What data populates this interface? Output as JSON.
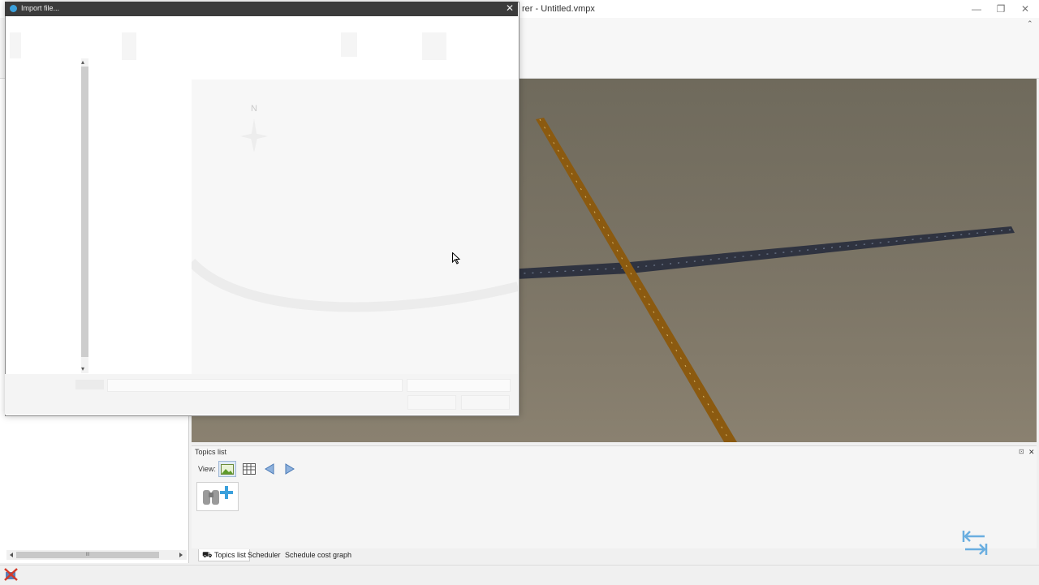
{
  "app": {
    "title_fragment": "rer - Untitled.vmpx",
    "minimize": "—",
    "restore": "❐",
    "close": "✕"
  },
  "dialog": {
    "title": "Import file...",
    "close": "✕",
    "compass_letter": "N"
  },
  "topics": {
    "title": "Topics list",
    "view_label": "View:",
    "pin": "⊡",
    "close": "✕"
  },
  "tabs": {
    "topics_list": "Topics list",
    "scheduler": "Scheduler",
    "schedule_cost_graph": "Schedule cost graph"
  },
  "scrollbar": {
    "thumb_grip": "III"
  },
  "colors": {
    "road_brown": "#8b5a10",
    "road_dark": "#2f3340",
    "viewport_sky": "#6f6a5c",
    "accent_blue": "#3aa0dc"
  }
}
